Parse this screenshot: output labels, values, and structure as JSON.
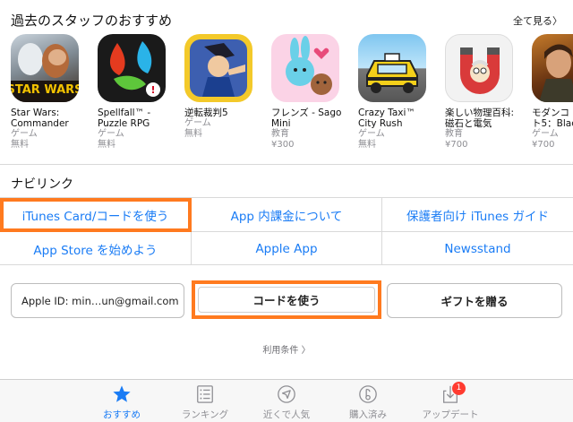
{
  "header": {
    "title": "過去のスタッフのおすすめ",
    "see_all": "全て見る〉"
  },
  "apps": [
    {
      "name": "Star Wars:",
      "name2": "Commander",
      "category": "ゲーム",
      "price": "無料",
      "icon": "star-wars-commander-icon"
    },
    {
      "name": "Spellfall™ -",
      "name2": "Puzzle RPG",
      "category": "ゲーム",
      "price": "無料",
      "icon": "spellfall-icon"
    },
    {
      "name": "逆転裁判5",
      "name2": "",
      "category": "ゲーム",
      "price": "無料",
      "icon": "gyakuten-saiban-icon"
    },
    {
      "name": "フレンズ - Sago",
      "name2": "Mini",
      "category": "教育",
      "price": "¥300",
      "icon": "sago-mini-friends-icon"
    },
    {
      "name": "Crazy Taxi™",
      "name2": "City Rush",
      "category": "ゲーム",
      "price": "無料",
      "icon": "crazy-taxi-icon"
    },
    {
      "name": "楽しい物理百科:",
      "name2": "磁石と電気",
      "category": "教育",
      "price": "¥700",
      "icon": "physics-magnet-icon"
    },
    {
      "name": "モダンコ",
      "name2": "ト5：Blac",
      "category": "ゲーム",
      "price": "¥700",
      "icon": "modern-combat-icon"
    }
  ],
  "navi": {
    "title": "ナビリンク",
    "links": [
      "iTunes Card/コードを使う",
      "App 内課金について",
      "保護者向け iTunes ガイド",
      "App Store を始めよう",
      "Apple App",
      "Newsstand"
    ]
  },
  "account": {
    "apple_id": "Apple ID: min…un@gmail.com",
    "redeem": "コードを使う",
    "gift": "ギフトを贈る"
  },
  "terms": "利用条件 〉",
  "tabs": [
    {
      "label": "おすすめ",
      "icon": "star-icon",
      "active": true
    },
    {
      "label": "ランキング",
      "icon": "list-icon"
    },
    {
      "label": "近くで人気",
      "icon": "location-arrow-icon"
    },
    {
      "label": "購入済み",
      "icon": "purchased-icon"
    },
    {
      "label": "アップデート",
      "icon": "download-icon",
      "badge": "1"
    }
  ],
  "colors": {
    "accent": "#1a7cf5",
    "highlight": "#ff7a1f",
    "badge": "#ff3b30"
  }
}
